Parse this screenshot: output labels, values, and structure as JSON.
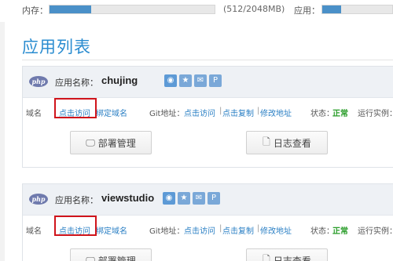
{
  "resources": {
    "memory_label": "内存：",
    "memory_value": "(512/2048MB)",
    "memory_fraction": 0.25,
    "app_label": "应用：",
    "app_fraction": 0.27
  },
  "page": {
    "title": "应用列表"
  },
  "labels": {
    "app_name": "应用名称：",
    "domain": "域名",
    "git": "Git地址：",
    "status": "状态：",
    "running": "运行实例：",
    "visit": "点击访问",
    "bind_domain": "绑定域名",
    "copy": "点击复制",
    "modify": "修改地址",
    "sep": "|",
    "deploy": "部署管理",
    "logs": "日志查看"
  },
  "apps": [
    {
      "name": "chujing",
      "status": "正常"
    },
    {
      "name": "viewstudio",
      "status": "正常"
    }
  ],
  "icons": [
    "weibo-icon",
    "star-icon",
    "wechat-icon",
    "p-icon"
  ]
}
